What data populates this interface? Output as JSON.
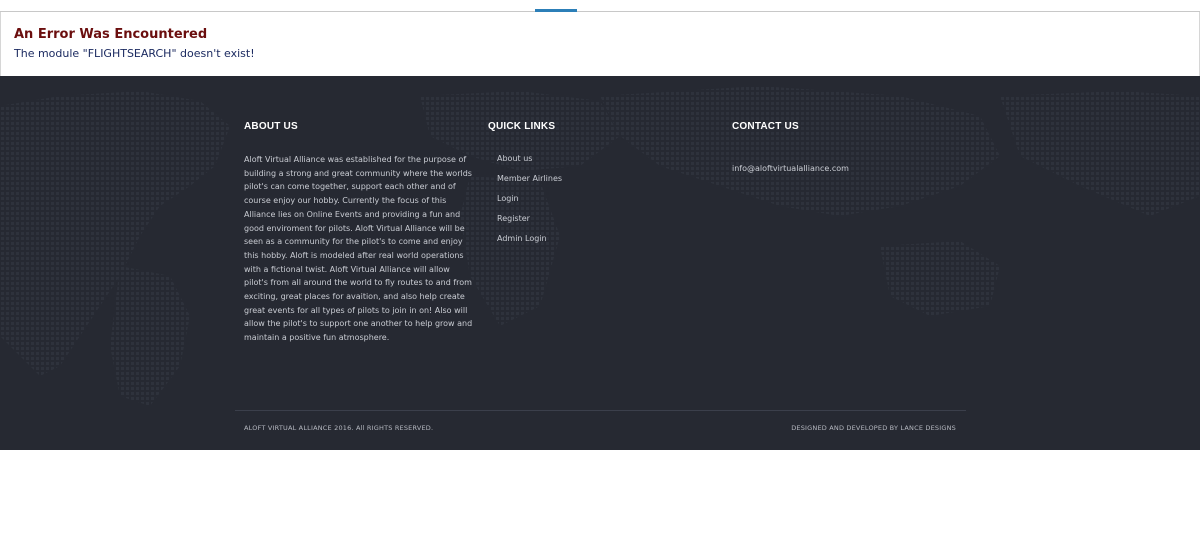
{
  "error": {
    "title": "An Error Was Encountered",
    "message": "The module \"FLIGHTSEARCH\" doesn't exist!"
  },
  "footer": {
    "about": {
      "title": "ABOUT US",
      "text": "Aloft Virtual Alliance was established for the purpose of building a strong and great community where the worlds pilot's can come together, support each other and of course enjoy our hobby. Currently the focus of this Alliance lies on Online Events and providing a fun and good enviroment for pilots. Aloft Virtual Alliance will be seen as a community for the pilot's to come and enjoy this hobby. Aloft is modeled after real world operations with a fictional twist. Aloft Virtual Alliance will allow pilot's from all around the world to fly routes to and from exciting, great places for avaition, and also help create great events for all types of pilots to join in on! Also will allow the pilot's to support one another to help grow and maintain a positive fun atmosphere."
    },
    "quick_links": {
      "title": "QUICK LINKS",
      "items": [
        "About us",
        "Member Airlines",
        "Login",
        "Register",
        "Admin Login"
      ]
    },
    "contact": {
      "title": "CONTACT US",
      "email": "info@aloftvirtualalliance.com"
    },
    "copyright": "ALOFT VIRTUAL ALLIANCE 2016. All RIGHTS RESERVED.",
    "designed_by": "DESIGNED AND DEVELOPED BY LANCE DESIGNS"
  },
  "colors": {
    "error_title": "#6b0e0e",
    "error_message": "#1b2a60",
    "footer_bg": "#262932",
    "accent": "#2c7fb8"
  }
}
